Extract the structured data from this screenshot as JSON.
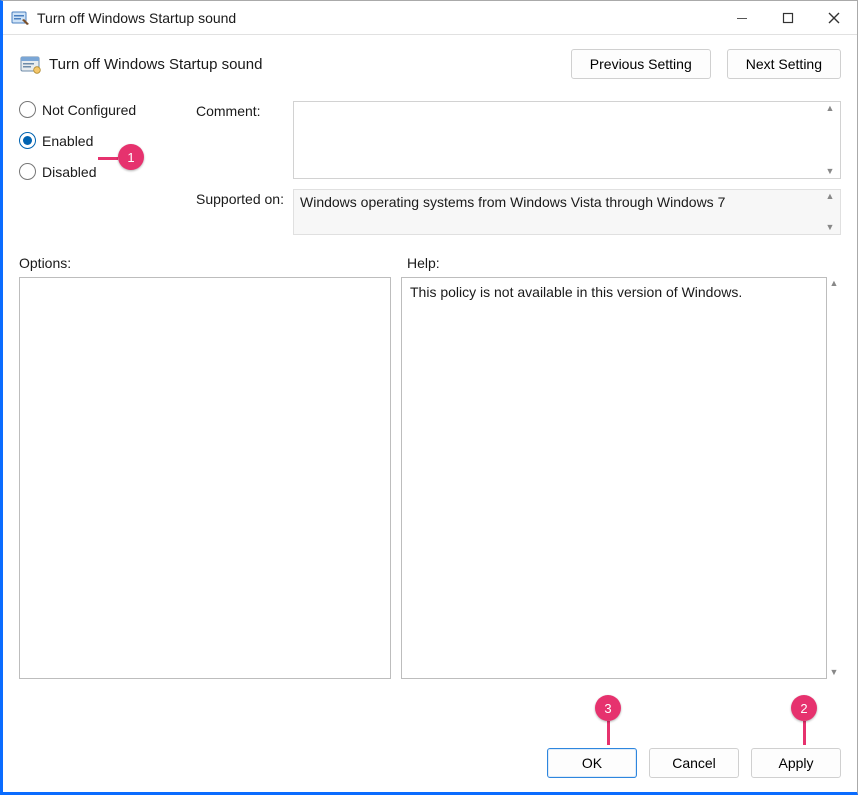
{
  "titlebar": {
    "title": "Turn off Windows Startup sound"
  },
  "header": {
    "policy_title": "Turn off Windows Startup sound",
    "prev_btn": "Previous Setting",
    "next_btn": "Next Setting"
  },
  "state": {
    "radios": {
      "not_configured": "Not Configured",
      "enabled": "Enabled",
      "disabled": "Disabled",
      "selected": "enabled"
    }
  },
  "comment": {
    "label": "Comment:",
    "value": ""
  },
  "supported": {
    "label": "Supported on:",
    "value": "Windows operating systems from Windows Vista through Windows 7"
  },
  "sections": {
    "options_label": "Options:",
    "help_label": "Help:",
    "help_text": "This policy is not available in this version of Windows."
  },
  "footer": {
    "ok": "OK",
    "cancel": "Cancel",
    "apply": "Apply"
  },
  "annotations": {
    "a1": "1",
    "a2": "2",
    "a3": "3"
  }
}
